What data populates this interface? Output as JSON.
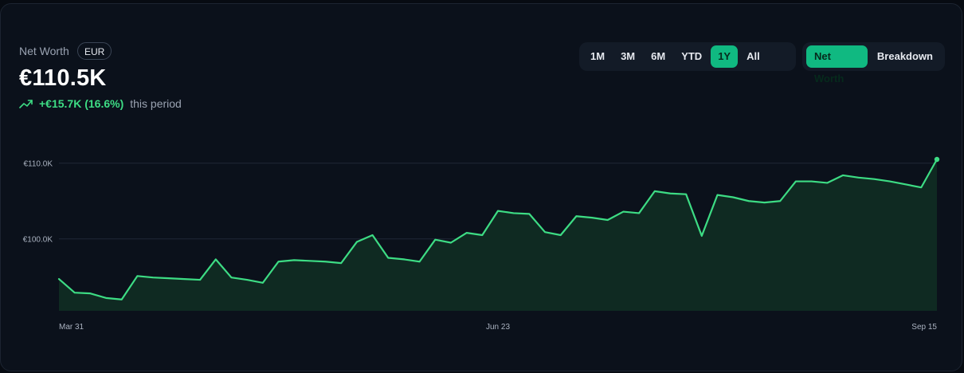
{
  "header": {
    "label": "Net Worth",
    "currency": "EUR",
    "value": "€110.5K",
    "change": "+€15.7K (16.6%)",
    "period": "this period"
  },
  "range_buttons": [
    {
      "label": "1M",
      "active": false
    },
    {
      "label": "3M",
      "active": false
    },
    {
      "label": "6M",
      "active": false
    },
    {
      "label": "YTD",
      "active": false
    },
    {
      "label": "1Y",
      "active": true
    },
    {
      "label": "All",
      "active": false
    }
  ],
  "view_buttons": [
    {
      "label": "Net Worth",
      "active": true
    },
    {
      "label": "Breakdown",
      "active": false
    }
  ],
  "colors": {
    "line": "#3ddc84",
    "area": "#0f2a22",
    "accent": "#10b981"
  },
  "chart_data": {
    "type": "area",
    "title": "",
    "xlabel": "",
    "ylabel": "",
    "ylim": [
      90.5,
      110.5
    ],
    "y_ticks": [
      {
        "value": 100.0,
        "label": "€100.0K"
      },
      {
        "value": 110.0,
        "label": "€110.0K"
      }
    ],
    "x_ticks": [
      {
        "index": 0,
        "label": "Mar 31"
      },
      {
        "index": 28,
        "label": "Jun 23"
      },
      {
        "index": 56,
        "label": "Sep 15"
      }
    ],
    "grid": true,
    "series": [
      {
        "values": [
          94.7,
          92.9,
          92.8,
          92.2,
          92.0,
          95.1,
          94.9,
          94.8,
          94.7,
          94.6,
          97.3,
          94.9,
          94.6,
          94.2,
          97.0,
          97.2,
          97.1,
          97.0,
          96.8,
          99.6,
          100.5,
          97.5,
          97.3,
          97.0,
          99.9,
          99.5,
          100.8,
          100.5,
          103.7,
          103.4,
          103.3,
          100.9,
          100.5,
          103.0,
          102.8,
          102.5,
          103.6,
          103.4,
          106.3,
          106.0,
          105.9,
          100.4,
          105.8,
          105.5,
          105.0,
          104.8,
          105.0,
          107.6,
          107.6,
          107.4,
          108.4,
          108.1,
          107.9,
          107.6,
          107.2,
          106.8,
          110.5
        ]
      }
    ]
  }
}
